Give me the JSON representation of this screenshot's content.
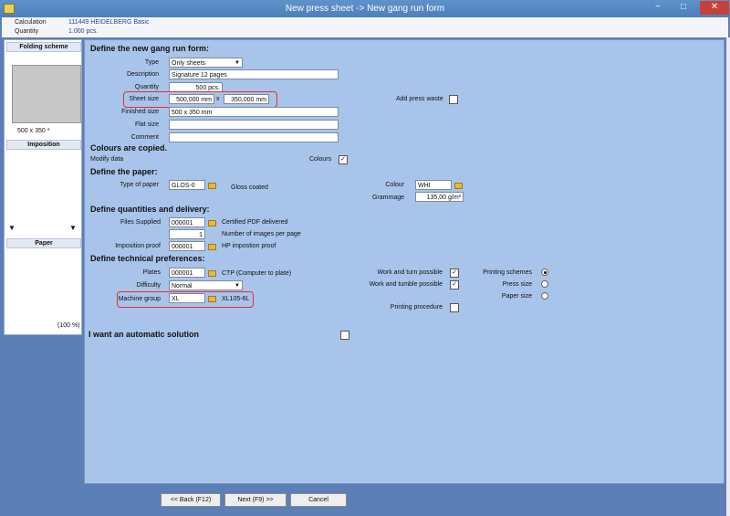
{
  "window": {
    "title": "New press sheet -> New gang run form",
    "min_label": "−",
    "max_label": "□",
    "close_label": "✕"
  },
  "info": {
    "calc_label": "Calculation",
    "calc_value": "111449 HEIDELBERG Basic",
    "qty_label": "Quantity",
    "qty_value": "1.000 pcs."
  },
  "left": {
    "folding_title": "Folding scheme",
    "folding_size": "500 x 350 *",
    "imposition_title": "Imposition",
    "paper_title": "Paper",
    "paper_pct": "(100 %)"
  },
  "form": {
    "s1_title": "Define the new gang run form:",
    "type_label": "Type",
    "type_value": "Only sheets",
    "desc_label": "Description",
    "desc_value": "Signature 12 pages",
    "qty_label": "Quantity",
    "qty_value": "500 pcs.",
    "sheet_label": "Sheet size",
    "sheet_w": "500,000 mm",
    "sheet_x": "x",
    "sheet_h": "350,000 mm",
    "press_waste_label": "Add press waste",
    "finished_label": "Finished size",
    "finished_value": "500 x 350 mm",
    "flat_label": "Flat size",
    "flat_value": "",
    "comment_label": "Comment",
    "comment_value": "",
    "s2_title": "Colours are copied.",
    "modify_label": "Modify data",
    "colours_label": "Colours",
    "colours_checked": "✓",
    "s3_title": "Define the paper:",
    "paper_type_label": "Type of paper",
    "paper_type_value": "GLOS-0",
    "paper_type_desc": "Gloss coated",
    "colour_label": "Colour",
    "colour_value": "WHI",
    "grammage_label": "Grammage",
    "grammage_value": "135,00 g/m²",
    "s4_title": "Define quantities and delivery:",
    "files_label": "Files Supplied",
    "files_value": "000001",
    "files_desc": "Certified PDF delivered",
    "images_value": "1",
    "images_desc": "Number of images per page",
    "impproof_label": "Imposition proof",
    "impproof_value": "000001",
    "impproof_desc": "HP impostion proof",
    "s5_title": "Define technical preferences:",
    "plates_label": "Plates",
    "plates_value": "000001",
    "plates_desc": "CTP (Computer to plate)",
    "difficulty_label": "Difficulty",
    "difficulty_value": "Normal",
    "machine_label": "Machine group",
    "machine_value": "XL",
    "machine_desc": "XL105-6L",
    "wt_label": "Work and turn possible",
    "wt_checked": "✓",
    "wtu_label": "Work and tumble possible",
    "wtu_checked": "✓",
    "ps_label": "Printing schemes",
    "press_size_label": "Press size",
    "paper_size_label": "Paper size",
    "proc_label": "Printing procedure",
    "auto_label": "I want an automatic solution"
  },
  "buttons": {
    "back": "<< Back (F12)",
    "next": "Next (F9) >>",
    "cancel": "Cancel"
  }
}
